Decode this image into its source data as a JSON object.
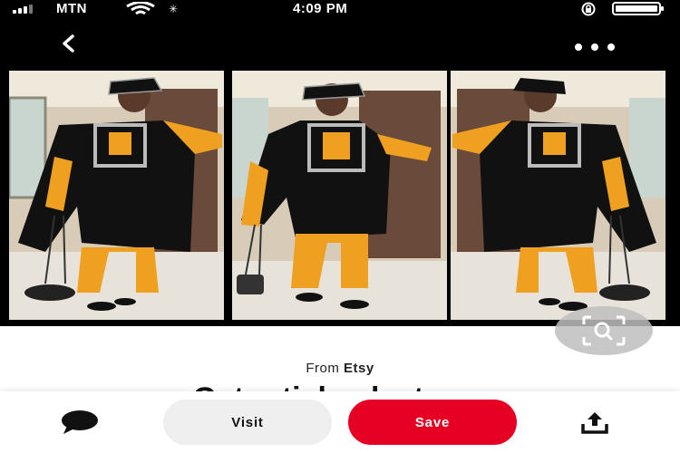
{
  "status_bar": {
    "carrier": "MTN",
    "time": "4:09 PM",
    "icons": [
      "signal-bars-icon",
      "wifi-icon",
      "activity-icon",
      "rotation-lock-icon",
      "battery-icon"
    ]
  },
  "nav": {
    "back_icon": "back-arrow-icon",
    "more_icon": "more-options-icon"
  },
  "pin": {
    "image_description_icon": "outfit-photo-collage",
    "visual_search_icon": "visual-search-icon"
  },
  "source": {
    "prefix": "From",
    "brand": "Etsy"
  },
  "title": {
    "text": "Get article pleat pos"
  },
  "actions": {
    "comment_icon": "comment-icon",
    "visit_label": "Visit",
    "save_label": "Save",
    "share_icon": "share-icon"
  },
  "colors": {
    "save_red": "#e60023",
    "visit_gray": "#efefef",
    "outfit_orange": "#f0a020",
    "outfit_black": "#111111"
  }
}
